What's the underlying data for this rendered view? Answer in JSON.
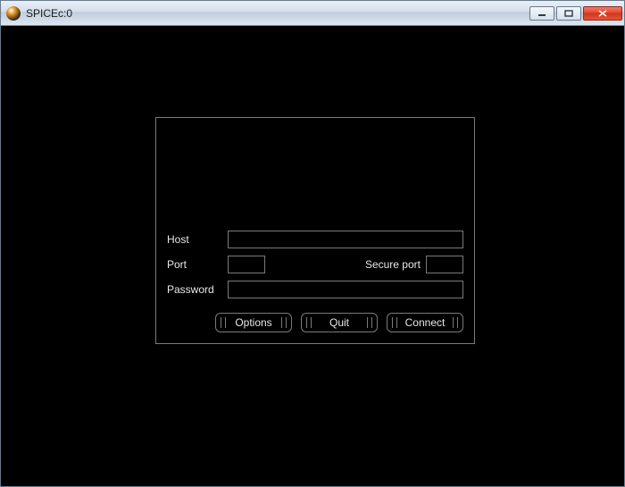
{
  "window": {
    "title": "SPICEc:0"
  },
  "form": {
    "host_label": "Host",
    "host_value": "",
    "port_label": "Port",
    "port_value": "",
    "secure_port_label": "Secure port",
    "secure_port_value": "",
    "password_label": "Password",
    "password_value": ""
  },
  "buttons": {
    "options": "Options",
    "quit": "Quit",
    "connect": "Connect"
  }
}
